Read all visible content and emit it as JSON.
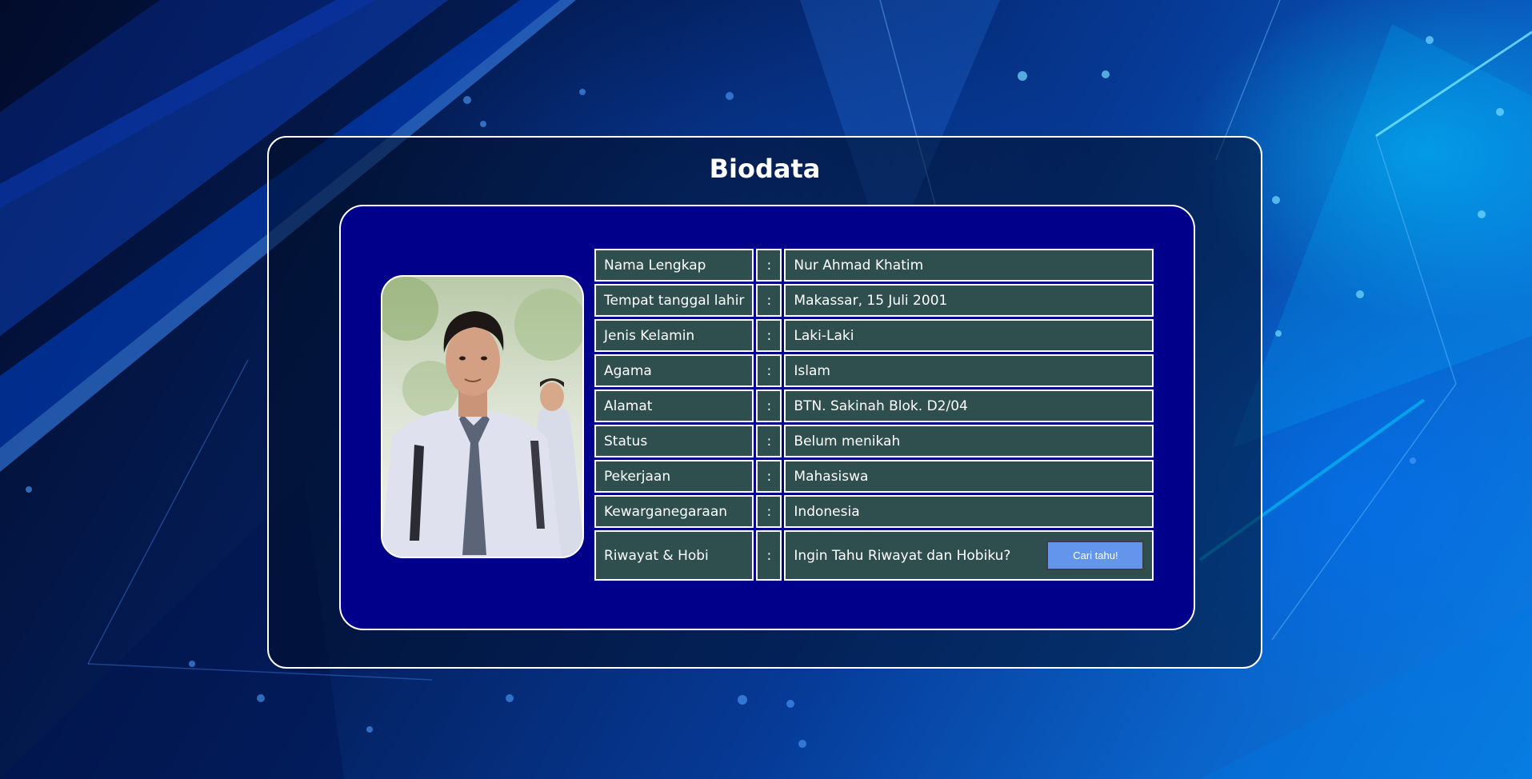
{
  "page": {
    "title": "Biodata"
  },
  "profile": {
    "rows": [
      {
        "label": "Nama Lengkap",
        "separator": ":",
        "value": "Nur Ahmad Khatim"
      },
      {
        "label": "Tempat tanggal lahir",
        "separator": ":",
        "value": "Makassar, 15 Juli 2001"
      },
      {
        "label": "Jenis Kelamin",
        "separator": ":",
        "value": "Laki-Laki"
      },
      {
        "label": "Agama",
        "separator": ":",
        "value": "Islam"
      },
      {
        "label": "Alamat",
        "separator": ":",
        "value": "BTN. Sakinah Blok. D2/04"
      },
      {
        "label": "Status",
        "separator": ":",
        "value": "Belum menikah"
      },
      {
        "label": "Pekerjaan",
        "separator": ":",
        "value": "Mahasiswa"
      },
      {
        "label": "Kewarganegaraan",
        "separator": ":",
        "value": "Indonesia"
      },
      {
        "label": "Riwayat & Hobi",
        "separator": ":",
        "value": "Ingin Tahu Riwayat dan Hobiku?"
      }
    ],
    "button_label": "Cari tahu!"
  },
  "colors": {
    "inner_card_bg": "#00008b",
    "cell_bg": "#2f4f4f",
    "button_bg": "#6495ed",
    "text": "#ffffff"
  },
  "icons": {
    "photo": "profile-photo"
  }
}
